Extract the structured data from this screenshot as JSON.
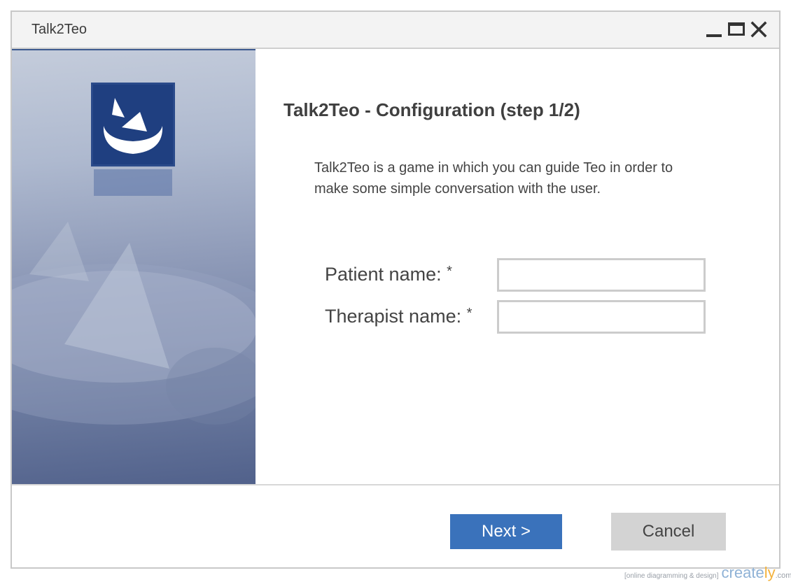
{
  "window": {
    "title": "Talk2Teo"
  },
  "side_panel": {
    "logo_icon": "talk2teo-logo-icon"
  },
  "content": {
    "title": "Talk2Teo - Configuration (step 1/2)",
    "description": "Talk2Teo is a game in which you can guide Teo in order to make some simple conversation with the user.",
    "fields": {
      "patient": {
        "label": "Patient name:",
        "required_mark": "*",
        "value": "",
        "placeholder": ""
      },
      "therapist": {
        "label": "Therapist name:",
        "required_mark": "*",
        "value": "",
        "placeholder": ""
      }
    }
  },
  "footer": {
    "next_label": "Next >",
    "cancel_label": "Cancel"
  },
  "watermark": {
    "tagline": "[online diagramming & design]",
    "brand_prefix": "creat",
    "brand_accent": "e",
    "brand_suffix": "ly",
    "domain": ".com"
  },
  "colors": {
    "accent": "#3a72bb",
    "cancel_bg": "#d3d3d3",
    "panel_dark": "#51618b",
    "panel_light": "#c4ccdb"
  }
}
